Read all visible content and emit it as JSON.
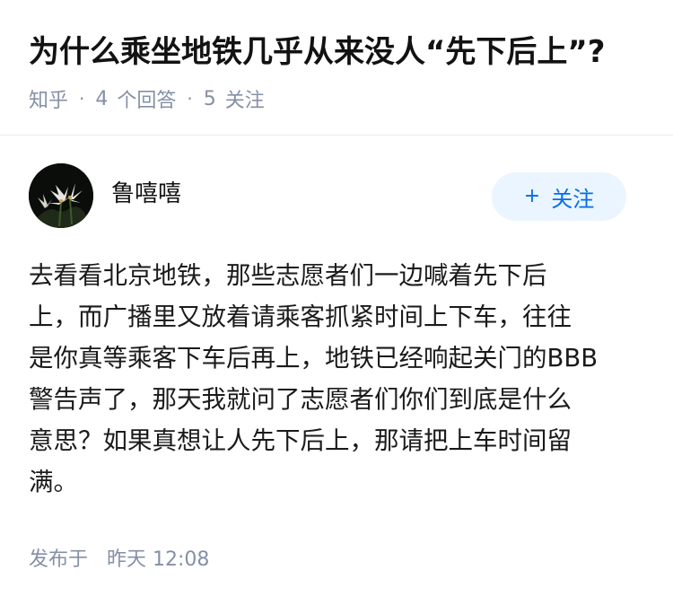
{
  "question": {
    "title": "为什么乘坐地铁几乎从来没人“先下后上”?",
    "source": "知乎",
    "answer_count": "4",
    "answer_label": "个回答",
    "follow_count": "5",
    "follow_label": "关注"
  },
  "author": {
    "name": "鲁嘻嘻",
    "avatar_icon": "lily-flower-avatar",
    "follow_button": "关注",
    "follow_icon": "+"
  },
  "answer": {
    "lines": [
      "去看看北京地铁，那些志愿者们一边喊着先下后",
      "上，而广播里又放着请乘客抓紧时间上下车，往往",
      "是你真等乘客下车后再上，地铁已经响起关门的BBB",
      "警告声了，那天我就问了志愿者们你们到底是什么",
      "意思？如果真想让人先下后上，那请把上车时间留",
      "满。"
    ]
  },
  "publish": {
    "label": "发布于",
    "time": "昨天 12:08"
  },
  "colors": {
    "meta_text": "#8590a6",
    "follow_bg": "#ebf5ff",
    "follow_text": "#056de8",
    "divider": "#ebebeb"
  }
}
